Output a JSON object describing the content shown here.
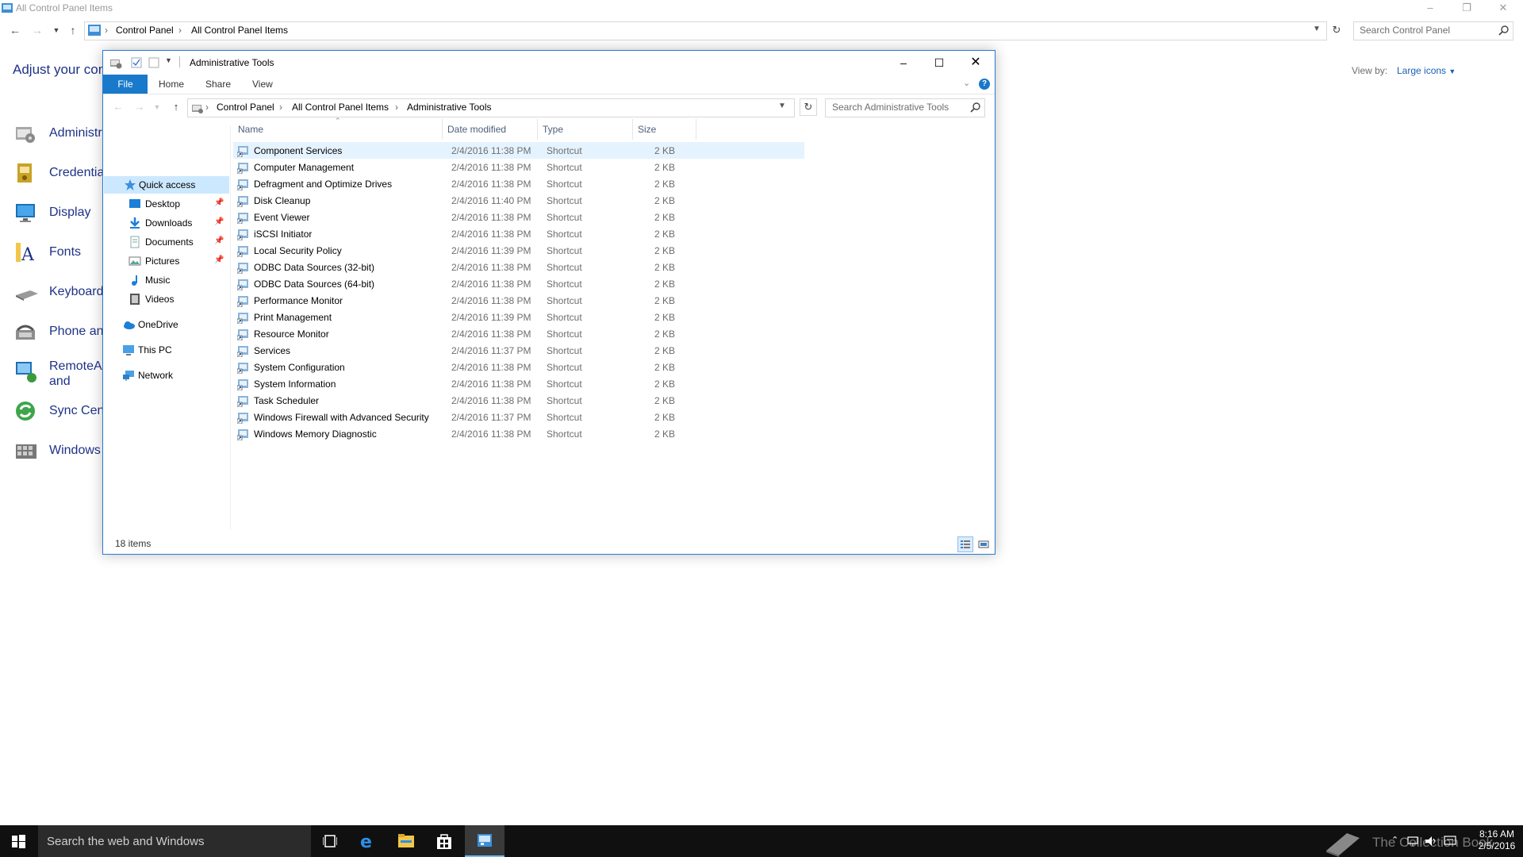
{
  "background_window": {
    "title": "All Control Panel Items",
    "breadcrumb": [
      "Control Panel",
      "All Control Panel Items"
    ],
    "search_placeholder": "Search Control Panel",
    "heading": "Adjust your com",
    "view_by_label": "View by:",
    "view_by_value": "Large icons",
    "items": [
      {
        "label": "Administrative Tools",
        "icon": "administrative-tools-icon"
      },
      {
        "label": "Credential Manager",
        "icon": "credential-manager-icon"
      },
      {
        "label": "Display",
        "icon": "display-icon"
      },
      {
        "label": "Fonts",
        "icon": "fonts-icon"
      },
      {
        "label": "Keyboard",
        "icon": "keyboard-icon"
      },
      {
        "label": "Phone and Modem",
        "icon": "phone-modem-icon"
      },
      {
        "label": "RemoteApp and Desktop Connections",
        "icon": "remoteapp-icon"
      },
      {
        "label": "Sync Center",
        "icon": "sync-center-icon"
      },
      {
        "label": "Windows To Go",
        "icon": "windows-to-go-icon"
      }
    ]
  },
  "explorer": {
    "title": "Administrative Tools",
    "ribbon_tabs": [
      "File",
      "Home",
      "Share",
      "View"
    ],
    "breadcrumb": [
      "Control Panel",
      "All Control Panel Items",
      "Administrative Tools"
    ],
    "search_placeholder": "Search Administrative Tools",
    "nav_pane": {
      "quick_access": "Quick access",
      "pinned": [
        {
          "label": "Desktop",
          "icon": "desktop-folder-icon",
          "pinned": true
        },
        {
          "label": "Downloads",
          "icon": "downloads-folder-icon",
          "pinned": true
        },
        {
          "label": "Documents",
          "icon": "documents-folder-icon",
          "pinned": true
        },
        {
          "label": "Pictures",
          "icon": "pictures-folder-icon",
          "pinned": true
        },
        {
          "label": "Music",
          "icon": "music-folder-icon",
          "pinned": false
        },
        {
          "label": "Videos",
          "icon": "videos-folder-icon",
          "pinned": false
        }
      ],
      "onedrive": "OneDrive",
      "this_pc": "This PC",
      "network": "Network"
    },
    "columns": {
      "name": "Name",
      "date": "Date modified",
      "type": "Type",
      "size": "Size"
    },
    "files": [
      {
        "name": "Component Services",
        "date": "2/4/2016 11:38 PM",
        "type": "Shortcut",
        "size": "2 KB"
      },
      {
        "name": "Computer Management",
        "date": "2/4/2016 11:38 PM",
        "type": "Shortcut",
        "size": "2 KB"
      },
      {
        "name": "Defragment and Optimize Drives",
        "date": "2/4/2016 11:38 PM",
        "type": "Shortcut",
        "size": "2 KB"
      },
      {
        "name": "Disk Cleanup",
        "date": "2/4/2016 11:40 PM",
        "type": "Shortcut",
        "size": "2 KB"
      },
      {
        "name": "Event Viewer",
        "date": "2/4/2016 11:38 PM",
        "type": "Shortcut",
        "size": "2 KB"
      },
      {
        "name": "iSCSI Initiator",
        "date": "2/4/2016 11:38 PM",
        "type": "Shortcut",
        "size": "2 KB"
      },
      {
        "name": "Local Security Policy",
        "date": "2/4/2016 11:39 PM",
        "type": "Shortcut",
        "size": "2 KB"
      },
      {
        "name": "ODBC Data Sources (32-bit)",
        "date": "2/4/2016 11:38 PM",
        "type": "Shortcut",
        "size": "2 KB"
      },
      {
        "name": "ODBC Data Sources (64-bit)",
        "date": "2/4/2016 11:38 PM",
        "type": "Shortcut",
        "size": "2 KB"
      },
      {
        "name": "Performance Monitor",
        "date": "2/4/2016 11:38 PM",
        "type": "Shortcut",
        "size": "2 KB"
      },
      {
        "name": "Print Management",
        "date": "2/4/2016 11:39 PM",
        "type": "Shortcut",
        "size": "2 KB"
      },
      {
        "name": "Resource Monitor",
        "date": "2/4/2016 11:38 PM",
        "type": "Shortcut",
        "size": "2 KB"
      },
      {
        "name": "Services",
        "date": "2/4/2016 11:37 PM",
        "type": "Shortcut",
        "size": "2 KB"
      },
      {
        "name": "System Configuration",
        "date": "2/4/2016 11:38 PM",
        "type": "Shortcut",
        "size": "2 KB"
      },
      {
        "name": "System Information",
        "date": "2/4/2016 11:38 PM",
        "type": "Shortcut",
        "size": "2 KB"
      },
      {
        "name": "Task Scheduler",
        "date": "2/4/2016 11:38 PM",
        "type": "Shortcut",
        "size": "2 KB"
      },
      {
        "name": "Windows Firewall with Advanced Security",
        "date": "2/4/2016 11:37 PM",
        "type": "Shortcut",
        "size": "2 KB"
      },
      {
        "name": "Windows Memory Diagnostic",
        "date": "2/4/2016 11:38 PM",
        "type": "Shortcut",
        "size": "2 KB"
      }
    ],
    "status": "18 items"
  },
  "taskbar": {
    "search_placeholder": "Search the web and Windows",
    "watermark": "The Collection Book",
    "time": "8:16 AM",
    "date": "2/5/2016"
  },
  "colors": {
    "accent": "#1979ca",
    "window_border": "#2b79d8",
    "link": "#1e3287",
    "taskbar": "#101010"
  }
}
